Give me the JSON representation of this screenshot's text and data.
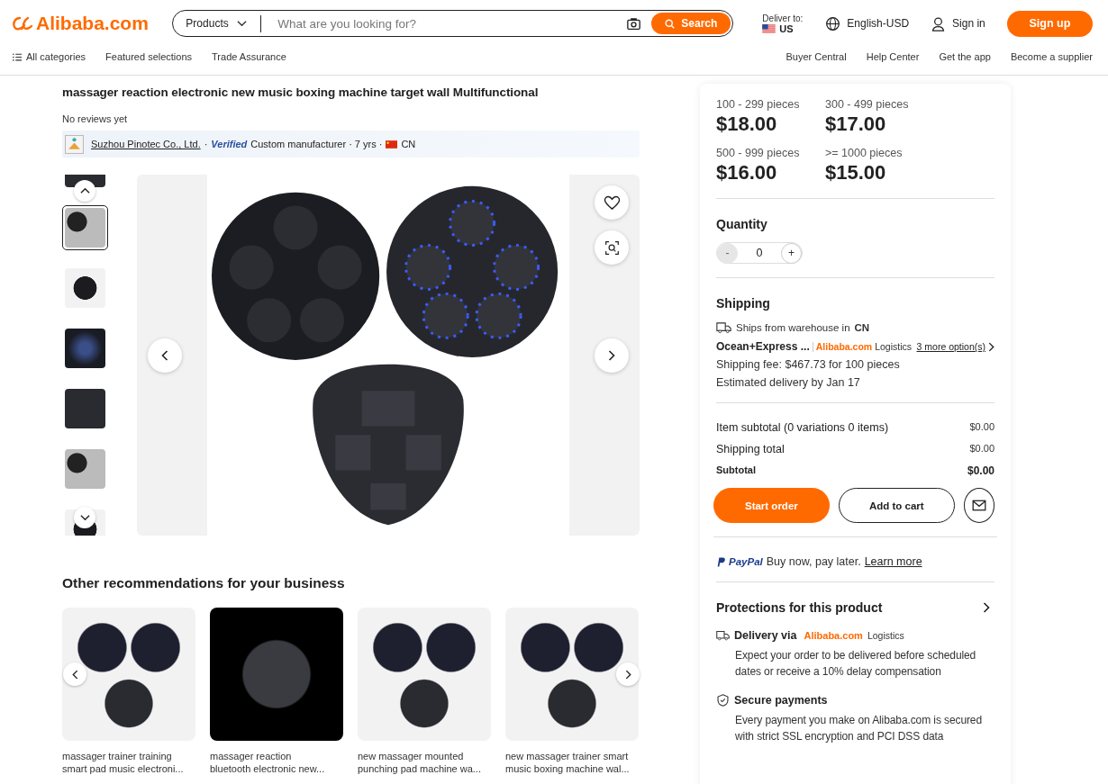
{
  "header": {
    "logo": "Alibaba.com",
    "search_category": "Products",
    "search_placeholder": "What are you looking for?",
    "search_button": "Search",
    "deliver_label": "Deliver to:",
    "deliver_country": "US",
    "language": "English-USD",
    "sign_in": "Sign in",
    "sign_up": "Sign up",
    "nav_left": [
      "All categories",
      "Featured selections",
      "Trade Assurance"
    ],
    "nav_right": [
      "Buyer Central",
      "Help Center",
      "Get the app",
      "Become a supplier"
    ]
  },
  "product": {
    "title": "massager reaction electronic new music boxing machine target wall Multifunctional",
    "reviews": "No reviews yet",
    "supplier": {
      "name": "Suzhou Pinotec Co., Ltd.",
      "separator": "·",
      "verified": "Verified",
      "details": "Custom manufacturer · 7 yrs ·",
      "country": "CN"
    }
  },
  "thumbnails": [
    {
      "selected": false
    },
    {
      "selected": true
    },
    {
      "selected": false
    },
    {
      "selected": false
    },
    {
      "selected": false
    },
    {
      "selected": false
    },
    {
      "selected": false
    }
  ],
  "recommendations": {
    "title": "Other recommendations for your business",
    "items": [
      {
        "title_lines": [
          "massager trainer training",
          "smart pad music electroni..."
        ],
        "dark": false
      },
      {
        "title_lines": [
          "massager reaction",
          "bluetooth electronic new..."
        ],
        "dark": true
      },
      {
        "title_lines": [
          "new massager mounted",
          "punching pad machine wa..."
        ],
        "dark": false
      },
      {
        "title_lines": [
          "new massager trainer smart",
          "music boxing machine wal..."
        ],
        "dark": false
      }
    ]
  },
  "price_tiers": [
    {
      "range": "100 - 299 pieces",
      "price": "$18.00"
    },
    {
      "range": "300 - 499 pieces",
      "price": "$17.00"
    },
    {
      "range": "500 - 999 pieces",
      "price": "$16.00"
    },
    {
      "range": ">= 1000 pieces",
      "price": "$15.00"
    }
  ],
  "quantity": {
    "label": "Quantity",
    "value": "0",
    "minus": "-",
    "plus": "+",
    "minus_disabled": true
  },
  "shipping": {
    "title": "Shipping",
    "from": "Ships from warehouse in",
    "from_country": "CN",
    "method": "Ocean+Express ...",
    "brand": "Alibaba.com",
    "brand_suffix": "Logistics",
    "more": "3 more option(s)",
    "fee": "Shipping fee: $467.73 for 100 pieces",
    "delivery": "Estimated delivery by Jan 17"
  },
  "totals": [
    {
      "label": "Item subtotal (0 variations 0 items)",
      "value": "$0.00",
      "emphasis": false
    },
    {
      "label": "Shipping total",
      "value": "$0.00",
      "emphasis": false
    },
    {
      "label": "Subtotal",
      "value": "$0.00",
      "emphasis": true
    }
  ],
  "actions": {
    "start": "Start order",
    "cart": "Add to cart"
  },
  "paypal": {
    "logo": "PayPal",
    "text": "Buy now, pay later.",
    "link": "Learn more"
  },
  "protections": {
    "title": "Protections for this product",
    "items": [
      {
        "kind": "delivery",
        "title": "Delivery via",
        "brand": "Alibaba.com",
        "brand_suffix": "Logistics",
        "text": "Expect your order to be delivered before scheduled dates or receive a 10% delay compensation"
      },
      {
        "kind": "secure",
        "title": "Secure payments",
        "text": "Every payment you make on Alibaba.com is secured with strict SSL encryption and PCI DSS data"
      }
    ]
  }
}
